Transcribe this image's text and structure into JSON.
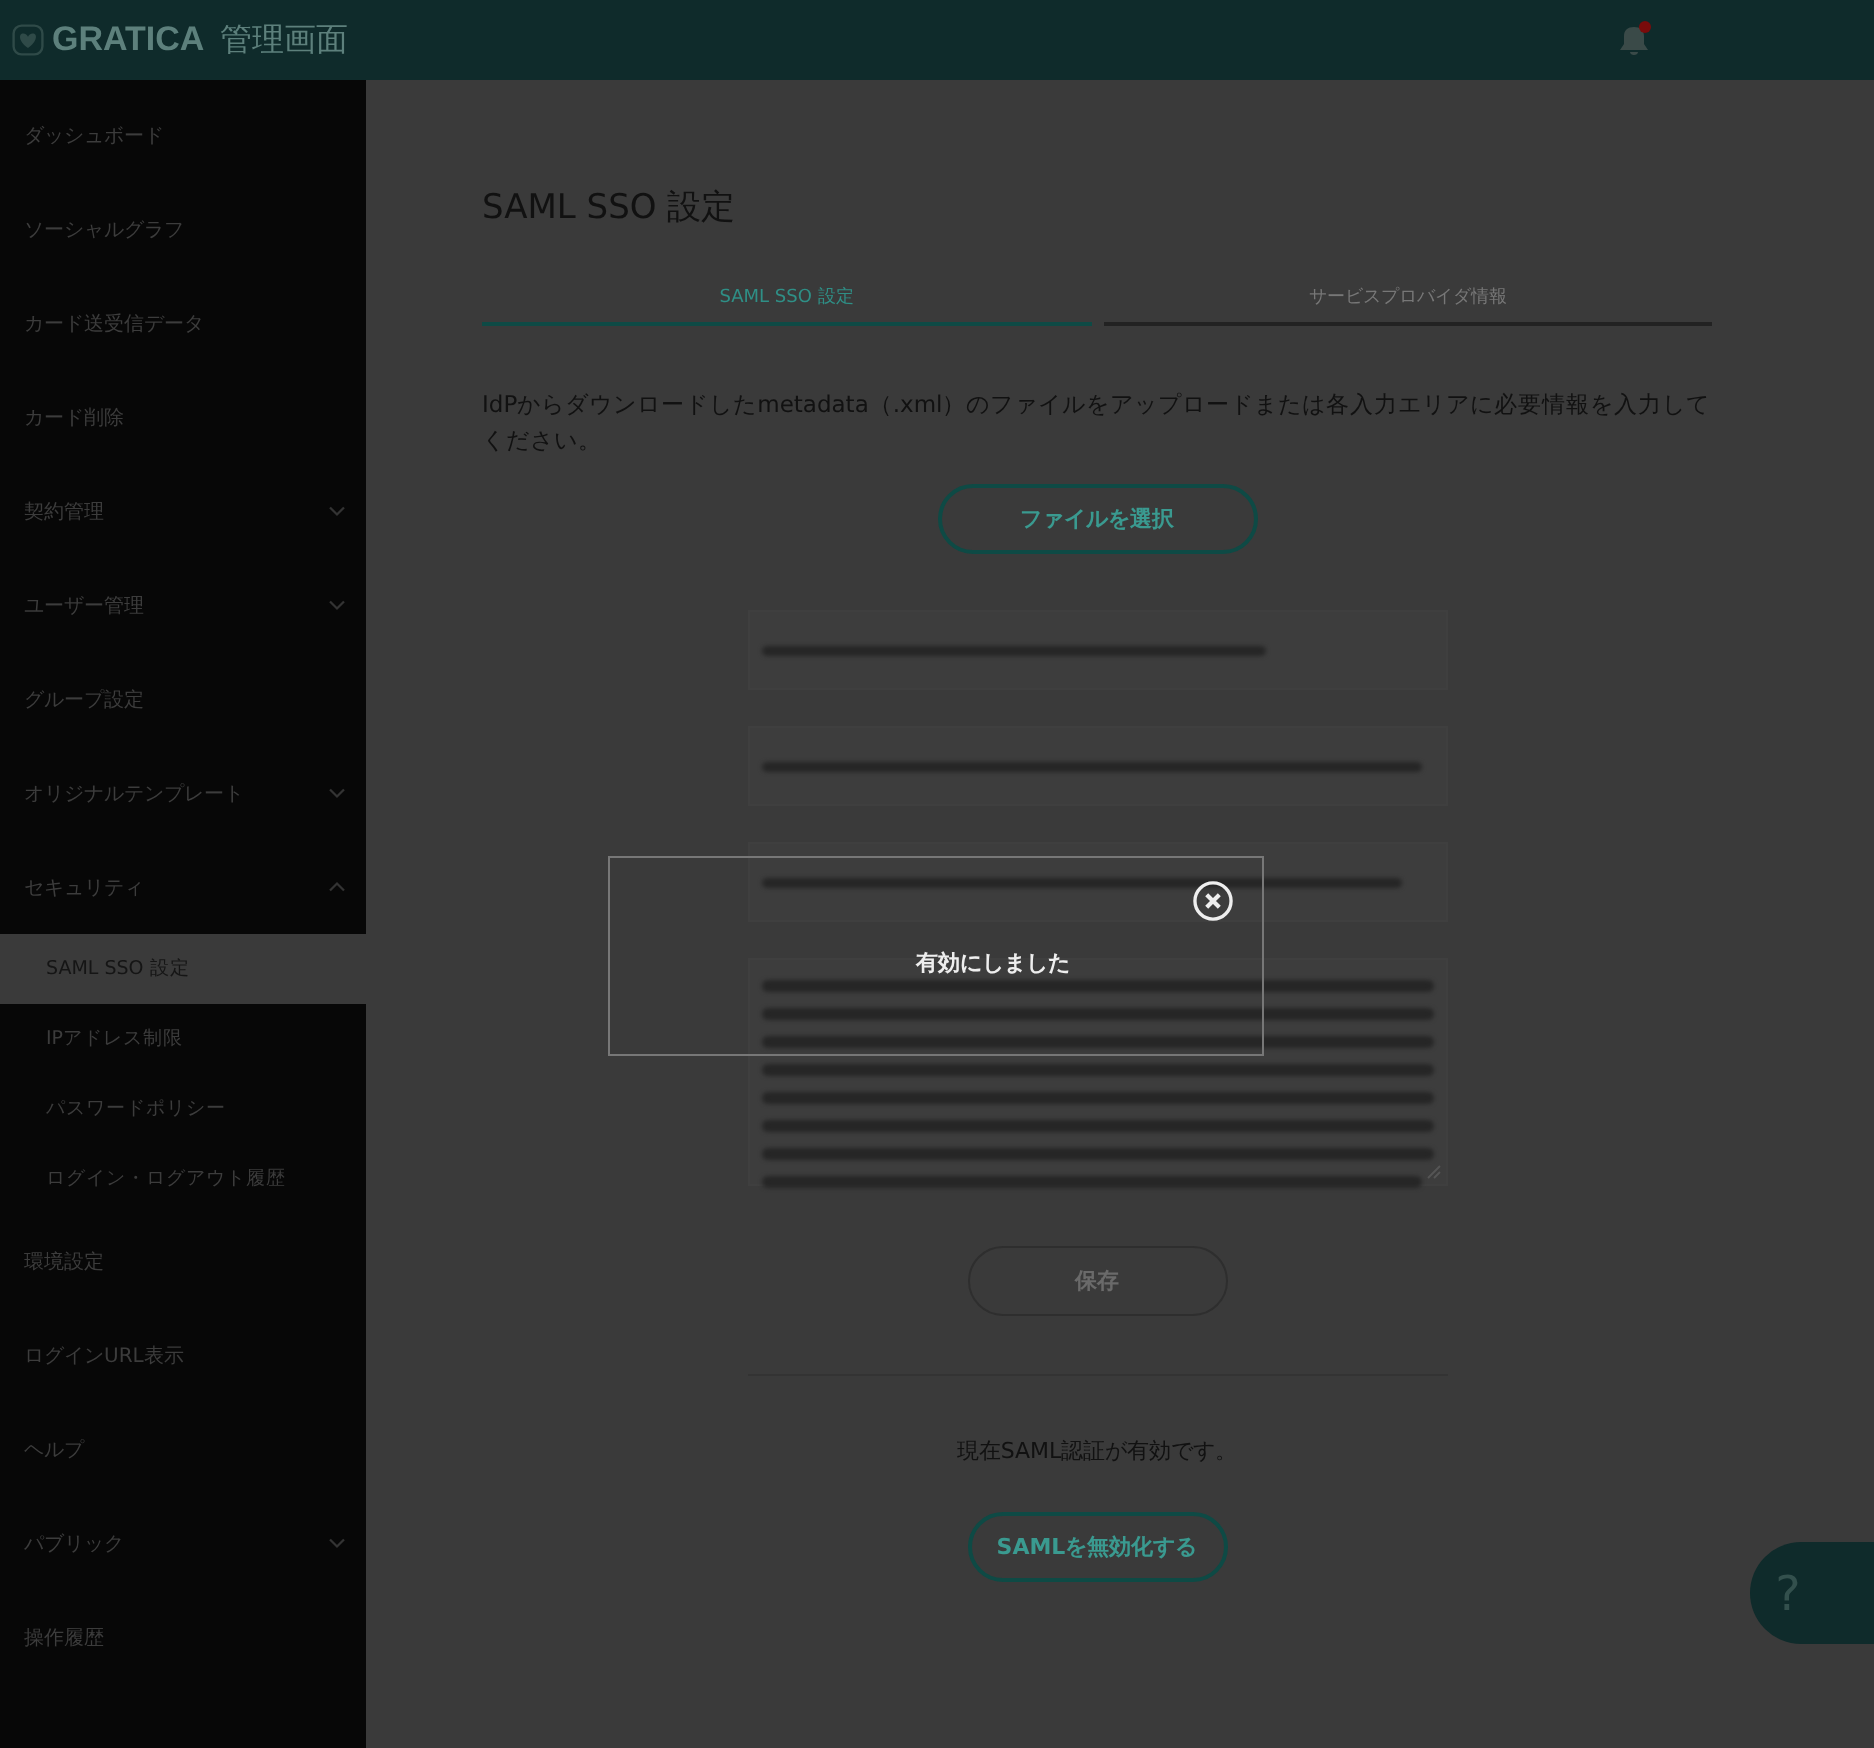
{
  "header": {
    "brand": "GRATICA",
    "subtitle": "管理画面",
    "notifications": {
      "unread": true
    }
  },
  "sidebar": {
    "items": [
      {
        "label": "ダッシュボード",
        "kind": "link",
        "selected": false
      },
      {
        "label": "ソーシャルグラフ",
        "kind": "link",
        "selected": false
      },
      {
        "label": "カード送受信データ",
        "kind": "link",
        "selected": false
      },
      {
        "label": "カード削除",
        "kind": "link",
        "selected": false
      },
      {
        "label": "契約管理",
        "kind": "group",
        "expanded": false,
        "selected": false
      },
      {
        "label": "ユーザー管理",
        "kind": "group",
        "expanded": false,
        "selected": false
      },
      {
        "label": "グループ設定",
        "kind": "link",
        "selected": false
      },
      {
        "label": "オリジナルテンプレート",
        "kind": "group",
        "expanded": false,
        "selected": false
      },
      {
        "label": "セキュリティ",
        "kind": "group",
        "expanded": true,
        "selected": false,
        "children": [
          {
            "label": "SAML SSO 設定",
            "selected": true
          },
          {
            "label": "IPアドレス制限",
            "selected": false
          },
          {
            "label": "パスワードポリシー",
            "selected": false
          },
          {
            "label": "ログイン・ログアウト履歴",
            "selected": false
          }
        ]
      },
      {
        "label": "環境設定",
        "kind": "link",
        "selected": false
      },
      {
        "label": "ログインURL表示",
        "kind": "link",
        "selected": false
      },
      {
        "label": "ヘルプ",
        "kind": "link",
        "selected": false
      },
      {
        "label": "パブリック",
        "kind": "group",
        "expanded": false,
        "selected": false
      },
      {
        "label": "操作履歴",
        "kind": "link",
        "selected": false
      }
    ]
  },
  "page": {
    "title": "SAML SSO 設定",
    "tabs": [
      {
        "label": "SAML SSO 設定",
        "selected": true
      },
      {
        "label": "サービスプロバイダ情報",
        "selected": false
      }
    ],
    "description": "IdPからダウンロードしたmetadata（.xml）のファイルをアップロードまたは各入力エリアに必要情報を入力してください。",
    "file_button": {
      "label": "ファイルを選択"
    },
    "fields": [
      {
        "kind": "input"
      },
      {
        "kind": "input"
      },
      {
        "kind": "input"
      },
      {
        "kind": "textarea"
      }
    ],
    "save_button": {
      "label": "保存",
      "disabled": true
    },
    "status": "現在SAML認証が有効です。",
    "disable_button": {
      "label": "SAMLを無効化する"
    }
  },
  "toast": {
    "message": "有効にしました"
  },
  "help_button": {
    "label": "?"
  }
}
